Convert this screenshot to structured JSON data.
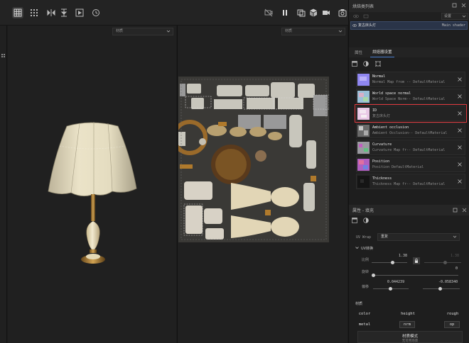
{
  "toolbar": {
    "tools": [
      "grid-icon",
      "pixel-grid-icon",
      "flip-icon",
      "pivot-icon",
      "frame-icon",
      "history-icon"
    ],
    "right_tools": [
      "camera-off-icon",
      "pause-icon",
      "layers-icon",
      "cube-icon",
      "video-icon",
      "screenshot-icon"
    ]
  },
  "viewport3d": {
    "select_value": "材质"
  },
  "viewport2d": {
    "select_value": "材质"
  },
  "bake_list": {
    "title": "烘焙类列表",
    "dropdown": "设置",
    "row_name": "复古床头灯",
    "row_shader": "Main shader"
  },
  "bake_settings": {
    "tabs": [
      "属性",
      "烘焙器设置"
    ],
    "active_tab": 1,
    "items": [
      {
        "title": "Normal",
        "subtitle": "Normal Map from -- DefaultMaterial",
        "thumb": "#8f86f0"
      },
      {
        "title": "World space normal",
        "subtitle": "World Space Norm-- DefaultMaterial",
        "thumb": "#9ac0d8"
      },
      {
        "title": "ID",
        "subtitle": "复古床头灯",
        "thumb": "#e9c8e6"
      },
      {
        "title": "Ambient occlusion",
        "subtitle": "Ambient Occlusion-- DefaultMaterial",
        "thumb": "#6a6a6a"
      },
      {
        "title": "Curvature",
        "subtitle": "Curvature Map fr-- DefaultMaterial",
        "thumb": "#9a9aa0"
      },
      {
        "title": "Position",
        "subtitle": "Position DefaultMaterial",
        "thumb": "#b060c0"
      },
      {
        "title": "Thickness",
        "subtitle": "Thickness Map fr-- DefaultMaterial",
        "thumb": "#151515"
      }
    ]
  },
  "properties": {
    "title": "属性 - 填充",
    "uv_wrap_label": "UV Wrap",
    "uv_wrap_value": "重复",
    "uv_transform_label": "UV转换",
    "scale_label": "比例",
    "scale_value": "1.38",
    "scale_value2": "1.38",
    "rotation_label": "旋转",
    "rotation_value": "0",
    "offset_label": "偏移",
    "offset_x": "0.044239",
    "offset_y": "-0.058340",
    "material_label": "材质",
    "channels": [
      "color",
      "height",
      "rough",
      "metal",
      "nrm",
      "op"
    ],
    "material_mode_label": "材质模式",
    "material_mode_sub": "无可用场景"
  },
  "colors": {
    "highlight": "#e0393e",
    "accent": "#4a7fd0"
  }
}
